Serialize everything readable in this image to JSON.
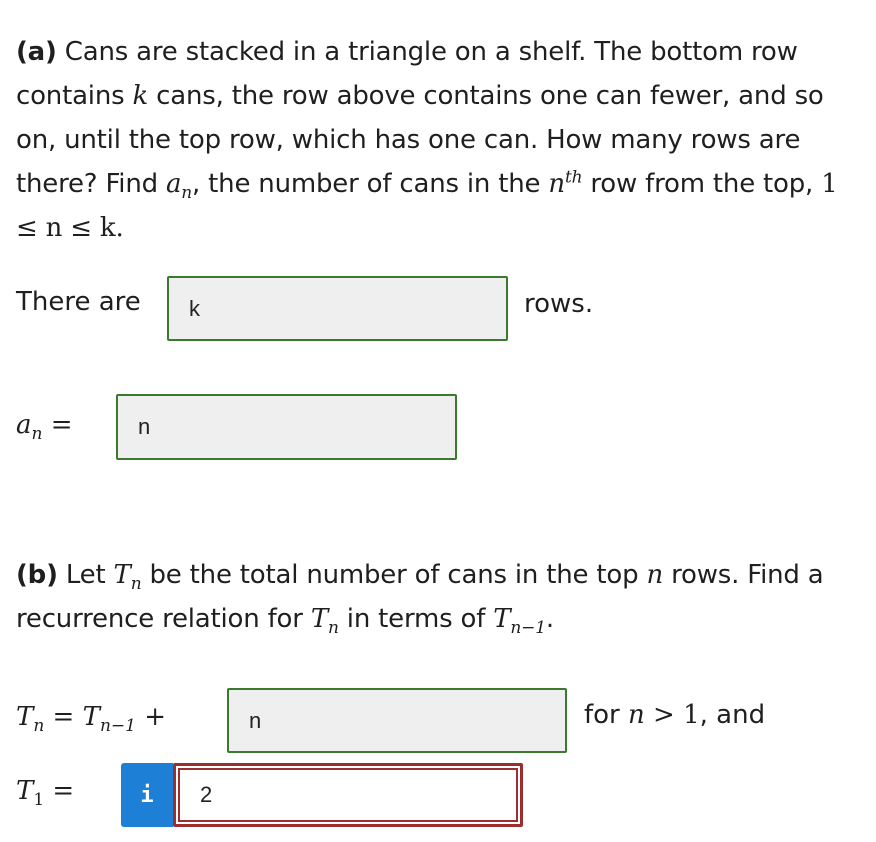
{
  "part_a": {
    "label": "(a)",
    "text1": " Cans are stacked in a triangle on a shelf. The bottom row contains ",
    "k": "k",
    "text2": " cans, the row above contains one can fewer, and so on, until the top row, which has one can. How many rows are there? Find ",
    "a": "a",
    "a_sub": "n",
    "text3": ", the number of cans in the ",
    "n": "n",
    "th": "th",
    "text4": " row from the top, ",
    "range": "1  ≤ n ≤ k.",
    "rows_prefix": "There are",
    "rows_value": "k",
    "rows_suffix": "rows.",
    "an_lhs": "a",
    "an_sub": "n",
    "an_eq": " =",
    "an_value": "n"
  },
  "part_b": {
    "label": "(b)",
    "text1": " Let ",
    "T": "T",
    "T_sub": "n",
    "text2": " be the total number of cans in the top ",
    "n": "n",
    "text3": " rows. Find a recurrence relation for ",
    "text4": " in terms of ",
    "Tm1_sub": "n−1",
    "text5": ".",
    "rec_lhs": "T",
    "rec_lhs_sub": "n",
    "rec_eq": " = ",
    "rec_rhs": "T",
    "rec_rhs_sub": "n−1",
    "rec_plus": " +",
    "rec_value": "n",
    "rec_cond_prefix": "for ",
    "rec_cond_n": "n",
    "rec_cond_rest": " > 1",
    "rec_cond_suffix": ", and",
    "t1_lhs": "T",
    "t1_sub": "1",
    "t1_eq": " =",
    "info_glyph": "i",
    "t1_value": "2"
  }
}
